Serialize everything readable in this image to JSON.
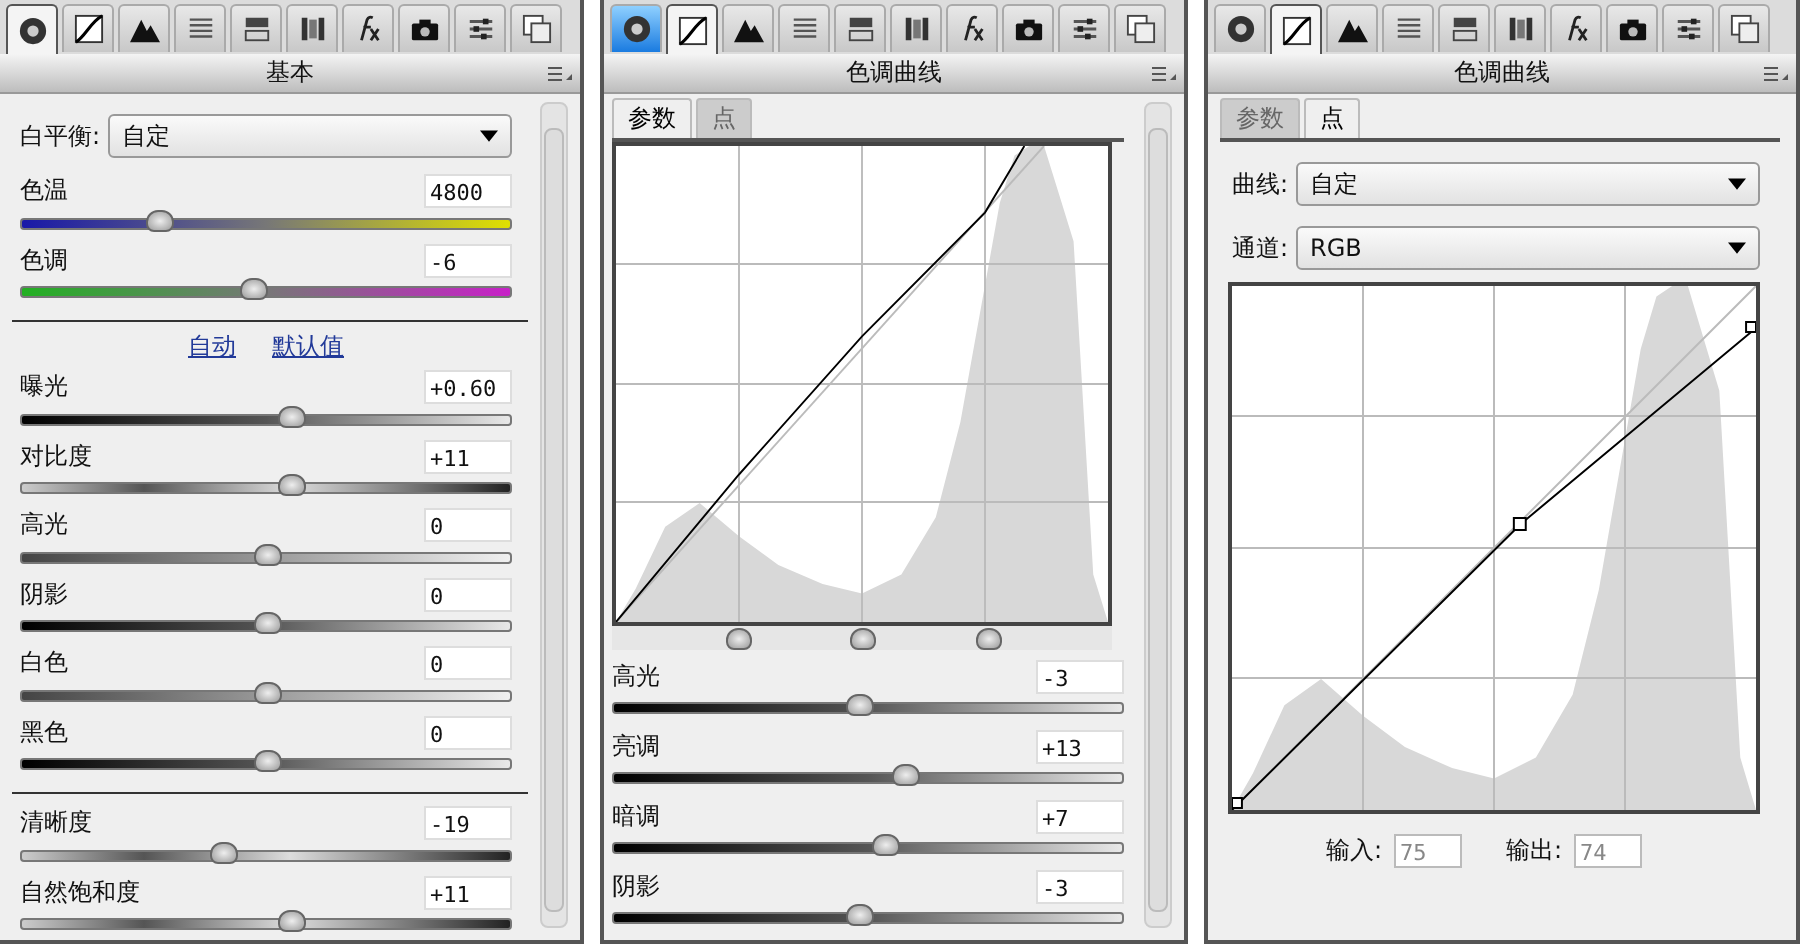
{
  "panels": [
    {
      "kind": "basic",
      "toolbar": [
        {
          "kind": "aperture",
          "selected": true,
          "highlighted": false
        },
        {
          "kind": "curve",
          "selected": false,
          "highlighted": false
        },
        {
          "kind": "mountain",
          "selected": false,
          "highlighted": false
        },
        {
          "kind": "lines",
          "selected": false,
          "highlighted": false
        },
        {
          "kind": "split",
          "selected": false,
          "highlighted": false
        },
        {
          "kind": "lens",
          "selected": false,
          "highlighted": false
        },
        {
          "kind": "fx",
          "selected": false,
          "highlighted": false
        },
        {
          "kind": "camera",
          "selected": false,
          "highlighted": false
        },
        {
          "kind": "sliders",
          "selected": false,
          "highlighted": false
        },
        {
          "kind": "pages",
          "selected": false,
          "highlighted": false
        }
      ],
      "title": "基本",
      "white_balance": {
        "label": "白平衡:",
        "value": "自定"
      },
      "groups": [
        {
          "sliders": [
            {
              "label": "色温",
              "value": "4800",
              "kind": "temp",
              "level": 0.28
            },
            {
              "label": "色调",
              "value": "-6",
              "kind": "tint",
              "level": 0.47
            }
          ]
        },
        {
          "links": [
            "自动",
            "默认值"
          ],
          "sliders": [
            {
              "label": "曝光",
              "value": "+0.60",
              "kind": "dark",
              "level": 0.55
            },
            {
              "label": "对比度",
              "value": "+11",
              "kind": "contrast",
              "level": 0.55
            },
            {
              "label": "高光",
              "value": "0",
              "kind": "fade",
              "level": 0.5
            },
            {
              "label": "阴影",
              "value": "0",
              "kind": "dark",
              "level": 0.5
            },
            {
              "label": "白色",
              "value": "0",
              "kind": "fade",
              "level": 0.5
            },
            {
              "label": "黑色",
              "value": "0",
              "kind": "dark",
              "level": 0.5
            }
          ]
        },
        {
          "sliders": [
            {
              "label": "清晰度",
              "value": "-19",
              "kind": "contrast",
              "level": 0.41
            },
            {
              "label": "自然饱和度",
              "value": "+11",
              "kind": "contrast",
              "level": 0.55
            }
          ]
        }
      ]
    },
    {
      "kind": "parametric",
      "toolbar": [
        {
          "kind": "aperture",
          "selected": false,
          "highlighted": true
        },
        {
          "kind": "curve",
          "selected": true,
          "highlighted": false
        },
        {
          "kind": "mountain",
          "selected": false,
          "highlighted": false
        },
        {
          "kind": "lines",
          "selected": false,
          "highlighted": false
        },
        {
          "kind": "split",
          "selected": false,
          "highlighted": false
        },
        {
          "kind": "lens",
          "selected": false,
          "highlighted": false
        },
        {
          "kind": "fx",
          "selected": false,
          "highlighted": false
        },
        {
          "kind": "camera",
          "selected": false,
          "highlighted": false
        },
        {
          "kind": "sliders",
          "selected": false,
          "highlighted": false
        },
        {
          "kind": "pages",
          "selected": false,
          "highlighted": false
        }
      ],
      "title": "色调曲线",
      "tabs": [
        {
          "label": "参数",
          "selected": true
        },
        {
          "label": "点",
          "selected": false
        }
      ],
      "splits": [
        {
          "level": 0.25
        },
        {
          "level": 0.5
        },
        {
          "level": 0.75
        }
      ],
      "sliders": [
        {
          "label": "高光",
          "value": "-3",
          "kind": "dark",
          "level": 0.48
        },
        {
          "label": "亮调",
          "value": "+13",
          "kind": "dark",
          "level": 0.57
        },
        {
          "label": "暗调",
          "value": "+7",
          "kind": "dark",
          "level": 0.53
        },
        {
          "label": "阴影",
          "value": "-3",
          "kind": "dark",
          "level": 0.48
        }
      ]
    },
    {
      "kind": "point",
      "toolbar": [
        {
          "kind": "aperture",
          "selected": false,
          "highlighted": false
        },
        {
          "kind": "curve",
          "selected": true,
          "highlighted": false
        },
        {
          "kind": "mountain",
          "selected": false,
          "highlighted": false
        },
        {
          "kind": "lines",
          "selected": false,
          "highlighted": false
        },
        {
          "kind": "split",
          "selected": false,
          "highlighted": false
        },
        {
          "kind": "lens",
          "selected": false,
          "highlighted": false
        },
        {
          "kind": "fx",
          "selected": false,
          "highlighted": false
        },
        {
          "kind": "camera",
          "selected": false,
          "highlighted": false
        },
        {
          "kind": "sliders",
          "selected": false,
          "highlighted": false
        },
        {
          "kind": "pages",
          "selected": false,
          "highlighted": false
        }
      ],
      "title": "色调曲线",
      "tabs": [
        {
          "label": "参数",
          "selected": false
        },
        {
          "label": "点",
          "selected": true
        }
      ],
      "dropdowns": [
        {
          "label": "曲线:",
          "value": "自定"
        },
        {
          "label": "通道:",
          "value": "RGB"
        }
      ],
      "fields": [
        {
          "label": "输入:",
          "value": "75",
          "disabled": true
        },
        {
          "label": "输出:",
          "value": "74",
          "disabled": true
        }
      ]
    }
  ]
}
